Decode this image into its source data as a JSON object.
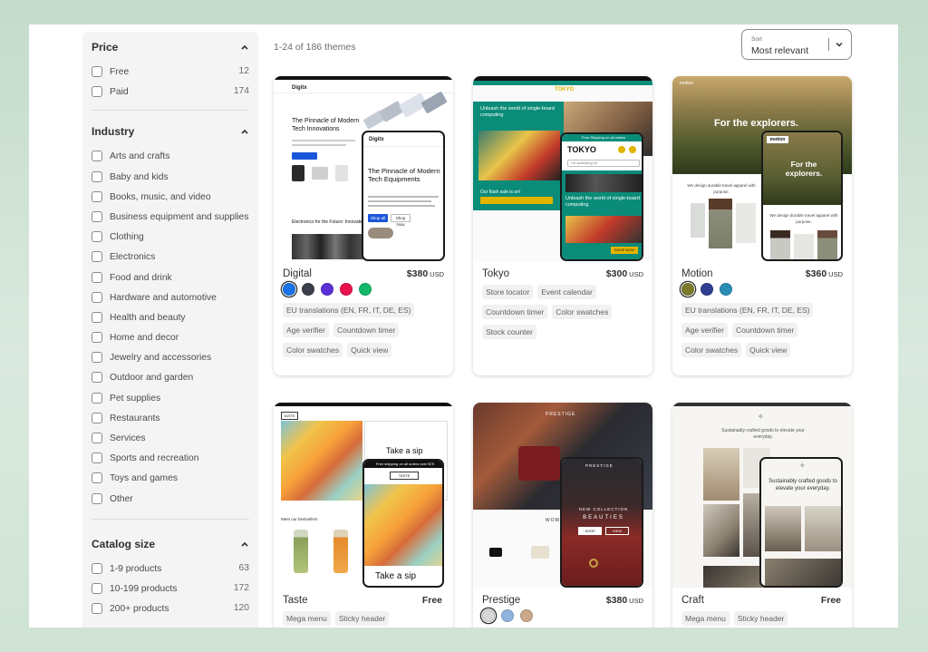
{
  "filters": {
    "price": {
      "title": "Price",
      "options": [
        {
          "label": "Free",
          "count": "12"
        },
        {
          "label": "Paid",
          "count": "174"
        }
      ]
    },
    "industry": {
      "title": "Industry",
      "options": [
        {
          "label": "Arts and crafts"
        },
        {
          "label": "Baby and kids"
        },
        {
          "label": "Books, music, and video"
        },
        {
          "label": "Business equipment and supplies"
        },
        {
          "label": "Clothing"
        },
        {
          "label": "Electronics"
        },
        {
          "label": "Food and drink"
        },
        {
          "label": "Hardware and automotive"
        },
        {
          "label": "Health and beauty"
        },
        {
          "label": "Home and decor"
        },
        {
          "label": "Jewelry and accessories"
        },
        {
          "label": "Outdoor and garden"
        },
        {
          "label": "Pet supplies"
        },
        {
          "label": "Restaurants"
        },
        {
          "label": "Services"
        },
        {
          "label": "Sports and recreation"
        },
        {
          "label": "Toys and games"
        },
        {
          "label": "Other"
        }
      ]
    },
    "catalog": {
      "title": "Catalog size",
      "options": [
        {
          "label": "1-9 products",
          "count": "63"
        },
        {
          "label": "10-199 products",
          "count": "172"
        },
        {
          "label": "200+ products",
          "count": "120"
        }
      ]
    }
  },
  "results": {
    "count_text": "1-24 of 186 themes"
  },
  "sort": {
    "caption": "Sort",
    "value": "Most relevant"
  },
  "themes": [
    {
      "name": "Digital",
      "price": "$380",
      "currency": "USD",
      "swatches": [
        "#1a73e8",
        "#3a3f4b",
        "#5b2fd6",
        "#e8134c",
        "#12b76a"
      ],
      "tags": [
        "EU translations (EN, FR, IT, DE, ES)",
        "Age verifier",
        "Countdown timer",
        "Color swatches",
        "Quick view"
      ],
      "preview": {
        "brand": "Digitx",
        "hero": "The Pinnacle of Modern Tech Innovations",
        "phone_hero": "The Pinnacle of Modern Tech Equipments",
        "subhead": "Electronics for the Future: Innovations",
        "cta": "Shop all",
        "cta2": "Shop Now"
      }
    },
    {
      "name": "Tokyo",
      "price": "$300",
      "currency": "USD",
      "swatches": [],
      "tags": [
        "Store locator",
        "Event calendar",
        "Countdown timer",
        "Color swatches",
        "Stock counter"
      ],
      "preview": {
        "brand": "TOKYO",
        "hero": "Unleash the world of single-board computing",
        "phone_hero": "Unleash the world of single-board computing",
        "sale": "Our flash sale is on!",
        "search": "I'm searching for",
        "notice": "Free Shipping on all orders",
        "cta": "SHOP NOW"
      }
    },
    {
      "name": "Motion",
      "price": "$360",
      "currency": "USD",
      "swatches": [
        "#7d7a2c",
        "#2f3f8f",
        "#2a8db5"
      ],
      "tags": [
        "EU translations (EN, FR, IT, DE, ES)",
        "Age verifier",
        "Countdown timer",
        "Color swatches",
        "Quick view"
      ],
      "preview": {
        "brand": "motion",
        "hero": "For the explorers.",
        "phone_hero": "For the explorers.",
        "body": "We design durable travel apparel with purpose.",
        "phone_body": "We design durable travel apparel with purpose."
      }
    },
    {
      "name": "Taste",
      "price": "Free",
      "currency": "",
      "swatches": [],
      "tags": [
        "Mega menu",
        "Sticky header"
      ],
      "preview": {
        "brand": "TASTE",
        "hero": "Take a sip",
        "phone_hero": "Take a sip",
        "banner": "Free shipping on all orders over $75",
        "sub": "Meet our bestsellers"
      }
    },
    {
      "name": "Prestige",
      "price": "$380",
      "currency": "USD",
      "swatches": [
        "#d9d9d9",
        "#8fb4dd",
        "#c9a88c"
      ],
      "tags": [],
      "preview": {
        "brand": "PRESTIGE",
        "phone_kicker": "NEW COLLECTION",
        "phone_hero": "BEAUTIES",
        "cta": "SHOP",
        "cta2": "VIEW",
        "women": "WOMEN"
      }
    },
    {
      "name": "Craft",
      "price": "Free",
      "currency": "",
      "swatches": [],
      "tags": [
        "Mega menu",
        "Sticky header"
      ],
      "preview": {
        "hero": "Sustainably crafted goods to elevate your everyday.",
        "phone_hero": "Sustainably crafted goods to elevate your everyday."
      }
    }
  ]
}
